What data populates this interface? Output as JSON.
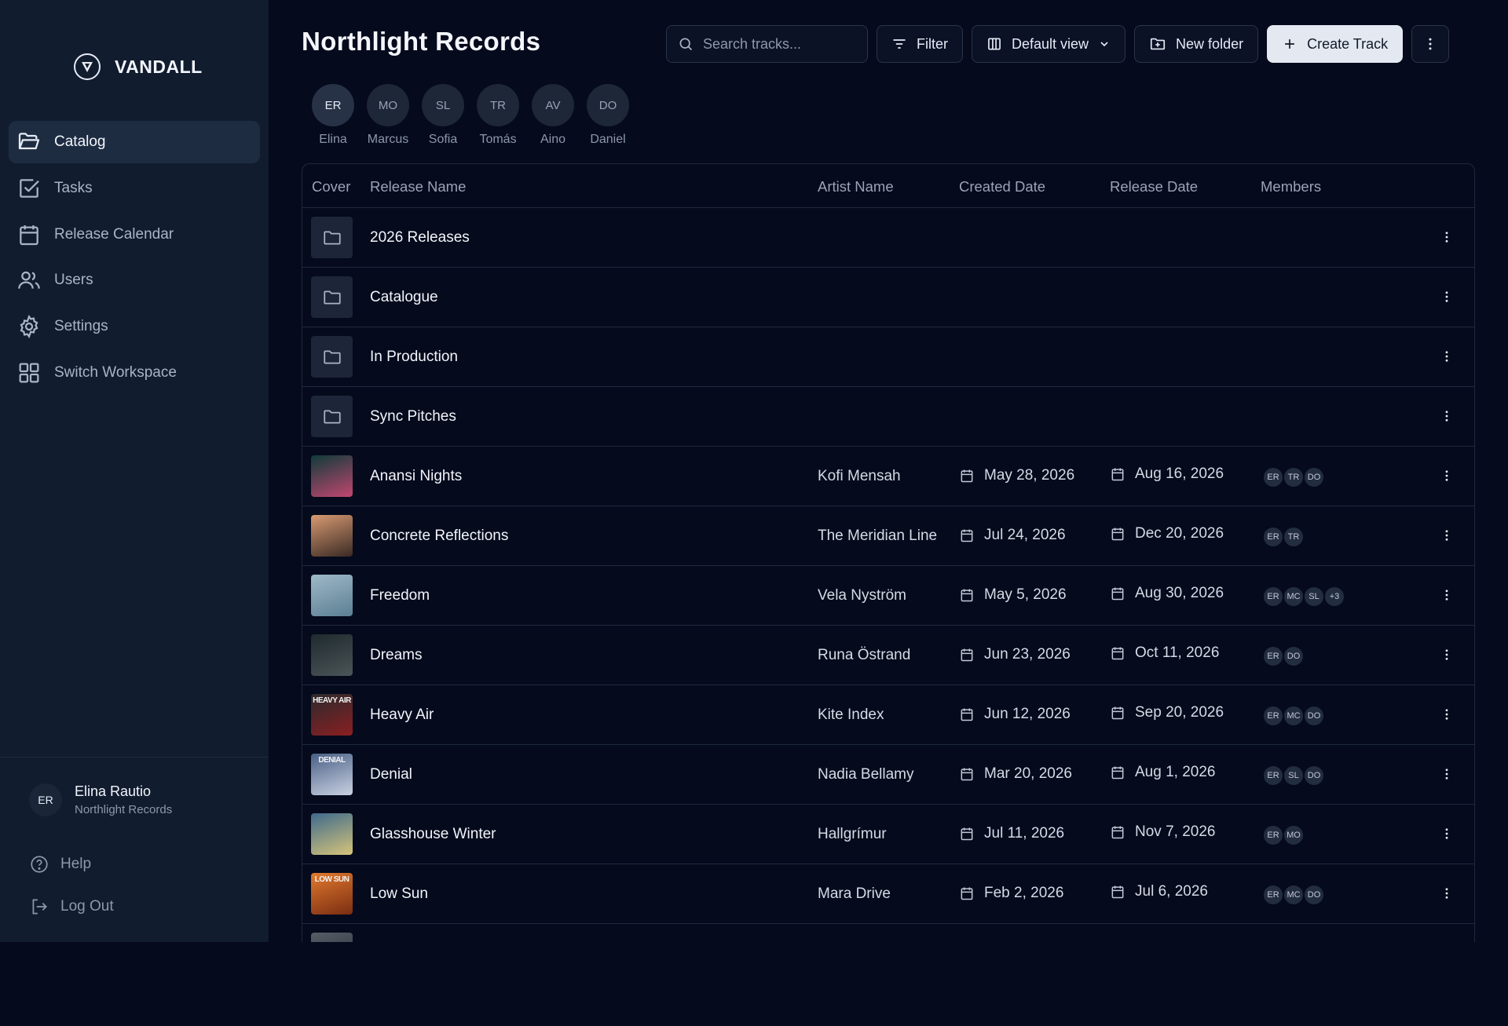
{
  "brand": {
    "name": "VANDALL"
  },
  "sidebar": {
    "items": [
      {
        "label": "Catalog",
        "icon": "folder-open-icon",
        "active": true
      },
      {
        "label": "Tasks",
        "icon": "checkbox-icon"
      },
      {
        "label": "Release Calendar",
        "icon": "calendar-icon"
      },
      {
        "label": "Users",
        "icon": "users-icon"
      },
      {
        "label": "Settings",
        "icon": "gear-icon"
      },
      {
        "label": "Switch Workspace",
        "icon": "grid-icon"
      }
    ],
    "profile": {
      "initials": "ER",
      "name": "Elina Rautio",
      "org": "Northlight Records"
    },
    "help_label": "Help",
    "logout_label": "Log Out"
  },
  "header": {
    "title": "Northlight Records",
    "search_placeholder": "Search tracks...",
    "filter_label": "Filter",
    "view_label": "Default view",
    "new_folder_label": "New folder",
    "create_label": "Create Track"
  },
  "team": [
    {
      "initials": "ER",
      "name": "Elina"
    },
    {
      "initials": "MO",
      "name": "Marcus"
    },
    {
      "initials": "SL",
      "name": "Sofia"
    },
    {
      "initials": "TR",
      "name": "Tomás"
    },
    {
      "initials": "AV",
      "name": "Aino"
    },
    {
      "initials": "DO",
      "name": "Daniel"
    }
  ],
  "table": {
    "columns": {
      "cover": "Cover",
      "release": "Release Name",
      "artist": "Artist Name",
      "created": "Created Date",
      "release_date": "Release Date",
      "members": "Members"
    },
    "folders": [
      {
        "name": "2026 Releases"
      },
      {
        "name": "Catalogue"
      },
      {
        "name": "In Production"
      },
      {
        "name": "Sync Pitches"
      }
    ],
    "tracks": [
      {
        "name": "Anansi Nights",
        "artist": "Kofi Mensah",
        "created": "May 28, 2026",
        "release": "Aug 16, 2026",
        "members": [
          "ER",
          "TR",
          "DO"
        ],
        "cover": [
          "#0f3b3a",
          "#c2476f"
        ]
      },
      {
        "name": "Concrete Reflections",
        "artist": "The Meridian Line",
        "created": "Jul 24, 2026",
        "release": "Dec 20, 2026",
        "members": [
          "ER",
          "TR"
        ],
        "cover": [
          "#d79a72",
          "#3a2a24"
        ]
      },
      {
        "name": "Freedom",
        "artist": "Vela Nyström",
        "created": "May 5, 2026",
        "release": "Aug 30, 2026",
        "members": [
          "ER",
          "MC",
          "SL",
          "+3"
        ],
        "cover": [
          "#9fb9c8",
          "#5b7f93"
        ]
      },
      {
        "name": "Dreams",
        "artist": "Runa Östrand",
        "created": "Jun 23, 2026",
        "release": "Oct 11, 2026",
        "members": [
          "ER",
          "DO"
        ],
        "cover": [
          "#1f2a2e",
          "#4b5558"
        ]
      },
      {
        "name": "Heavy Air",
        "artist": "Kite Index",
        "created": "Jun 12, 2026",
        "release": "Sep 20, 2026",
        "members": [
          "ER",
          "MC",
          "DO"
        ],
        "cover": [
          "#2b2a2c",
          "#8a1f22"
        ],
        "cover_text": "HEAVY AIR"
      },
      {
        "name": "Denial",
        "artist": "Nadia Bellamy",
        "created": "Mar 20, 2026",
        "release": "Aug 1, 2026",
        "members": [
          "ER",
          "SL",
          "DO"
        ],
        "cover": [
          "#4a5f86",
          "#c9d2e2"
        ],
        "cover_text": "DENIAL"
      },
      {
        "name": "Glasshouse Winter",
        "artist": "Hallgrímur",
        "created": "Jul 11, 2026",
        "release": "Nov 7, 2026",
        "members": [
          "ER",
          "MO"
        ],
        "cover": [
          "#3e6a8c",
          "#d6c47a"
        ]
      },
      {
        "name": "Low Sun",
        "artist": "Mara Drive",
        "created": "Feb 2, 2026",
        "release": "Jul 6, 2026",
        "members": [
          "ER",
          "MC",
          "DO"
        ],
        "cover": [
          "#e27a2e",
          "#7a2d12"
        ],
        "cover_text": "LOW SUN"
      }
    ]
  }
}
